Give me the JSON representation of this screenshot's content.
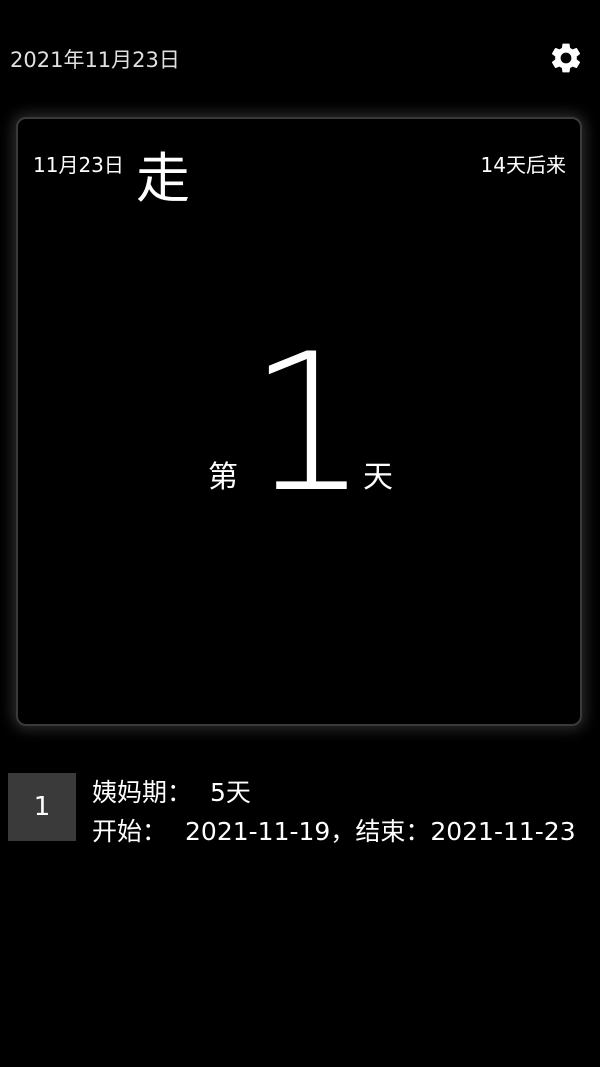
{
  "header": {
    "date": "2021年11月23日",
    "settings_icon": "gear-icon"
  },
  "card": {
    "date": "11月23日",
    "status": "走",
    "countdown": "14天后来",
    "day_prefix": "第",
    "day_number": "1",
    "day_suffix": "天"
  },
  "records": [
    {
      "index": "1",
      "period_label": "姨妈期：",
      "period_value": "5天",
      "start_label": "开始：",
      "start_value": "2021-11-19，",
      "end_label": "结束：",
      "end_value": "2021-11-23"
    }
  ],
  "colors": {
    "background": "#000000",
    "text": "#ffffff",
    "card_border": "#3a3a3a",
    "index_box": "#3a3a3a"
  }
}
